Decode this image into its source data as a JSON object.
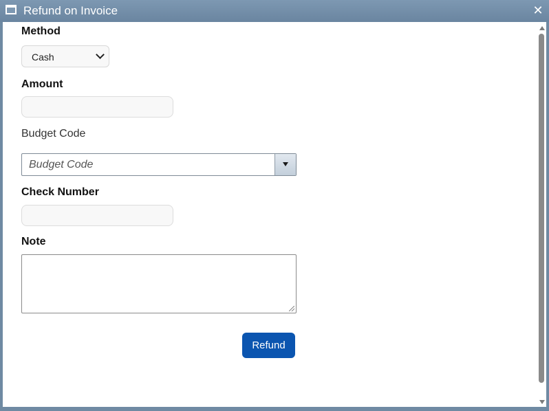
{
  "window": {
    "title": "Refund on Invoice",
    "close_icon": "close-icon",
    "title_icon": "window-icon"
  },
  "form": {
    "method_label": "Method",
    "method_value": "Cash",
    "amount_label": "Amount",
    "amount_value": "",
    "budget_code_label": "Budget Code",
    "budget_code_placeholder": "Budget Code",
    "check_number_label": "Check Number",
    "check_number_value": "",
    "note_label": "Note",
    "note_value": "",
    "refund_button_label": "Refund"
  },
  "colors": {
    "titlebar": "#6f8aa3",
    "primary_button": "#0b55b0"
  }
}
